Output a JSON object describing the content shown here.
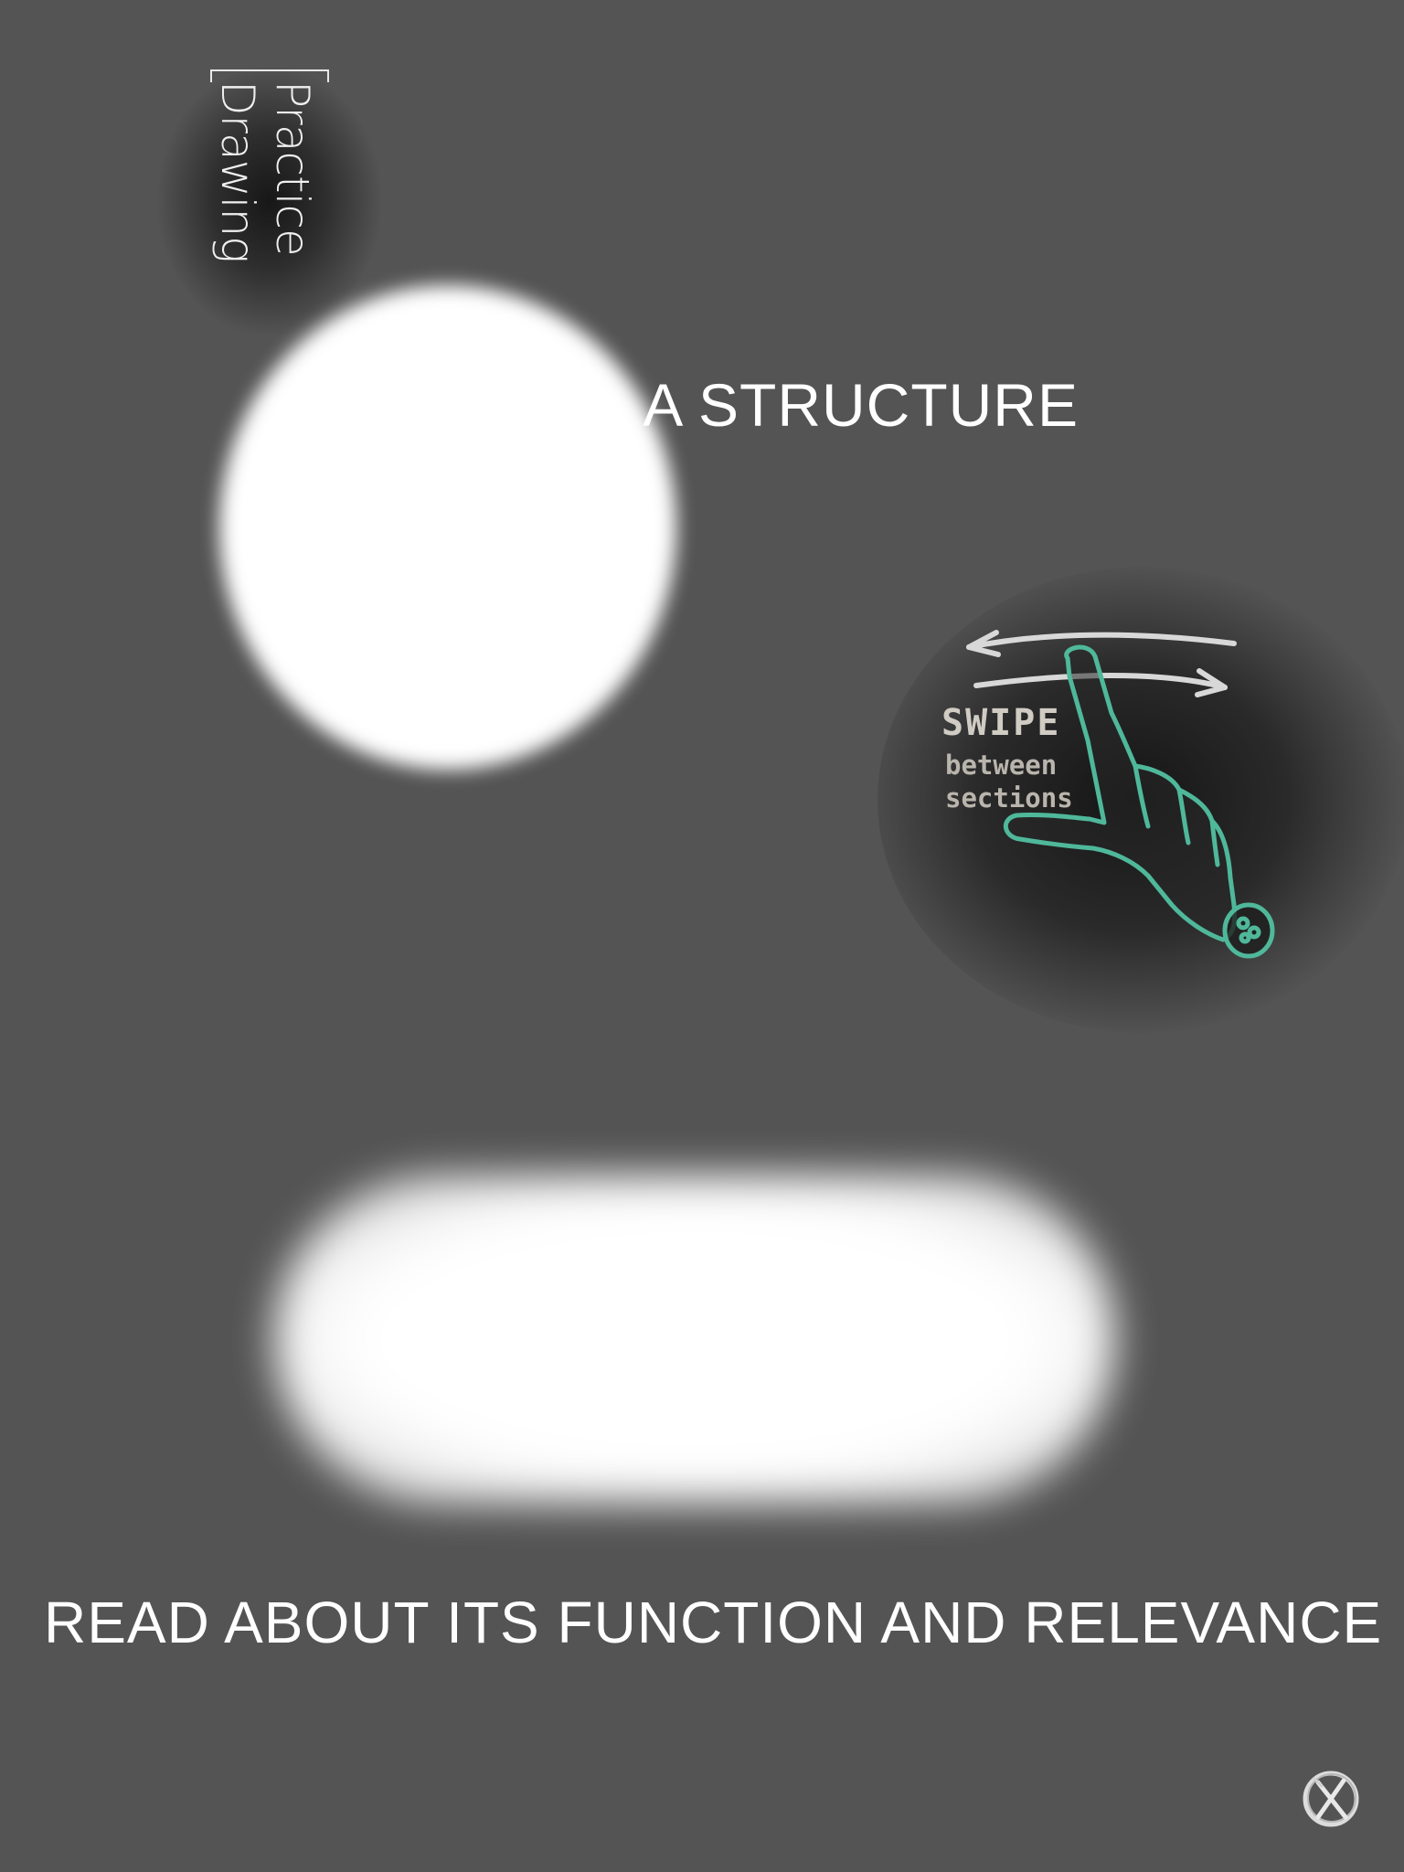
{
  "brand": {
    "line1": "Practice",
    "line2": "Drawing"
  },
  "heading_top": "A STRUCTURE",
  "swipe_hint": {
    "title": "SWIPE",
    "line1": "between",
    "line2": "sections",
    "icon": "hand-swipe-icon",
    "hand_color": "#4fb89a"
  },
  "heading_bottom": "READ ABOUT ITS FUNCTION AND RELEVANCE",
  "close": {
    "icon": "close-icon"
  },
  "colors": {
    "background": "#545454",
    "text": "#ffffff",
    "accent": "#4fb89a"
  }
}
